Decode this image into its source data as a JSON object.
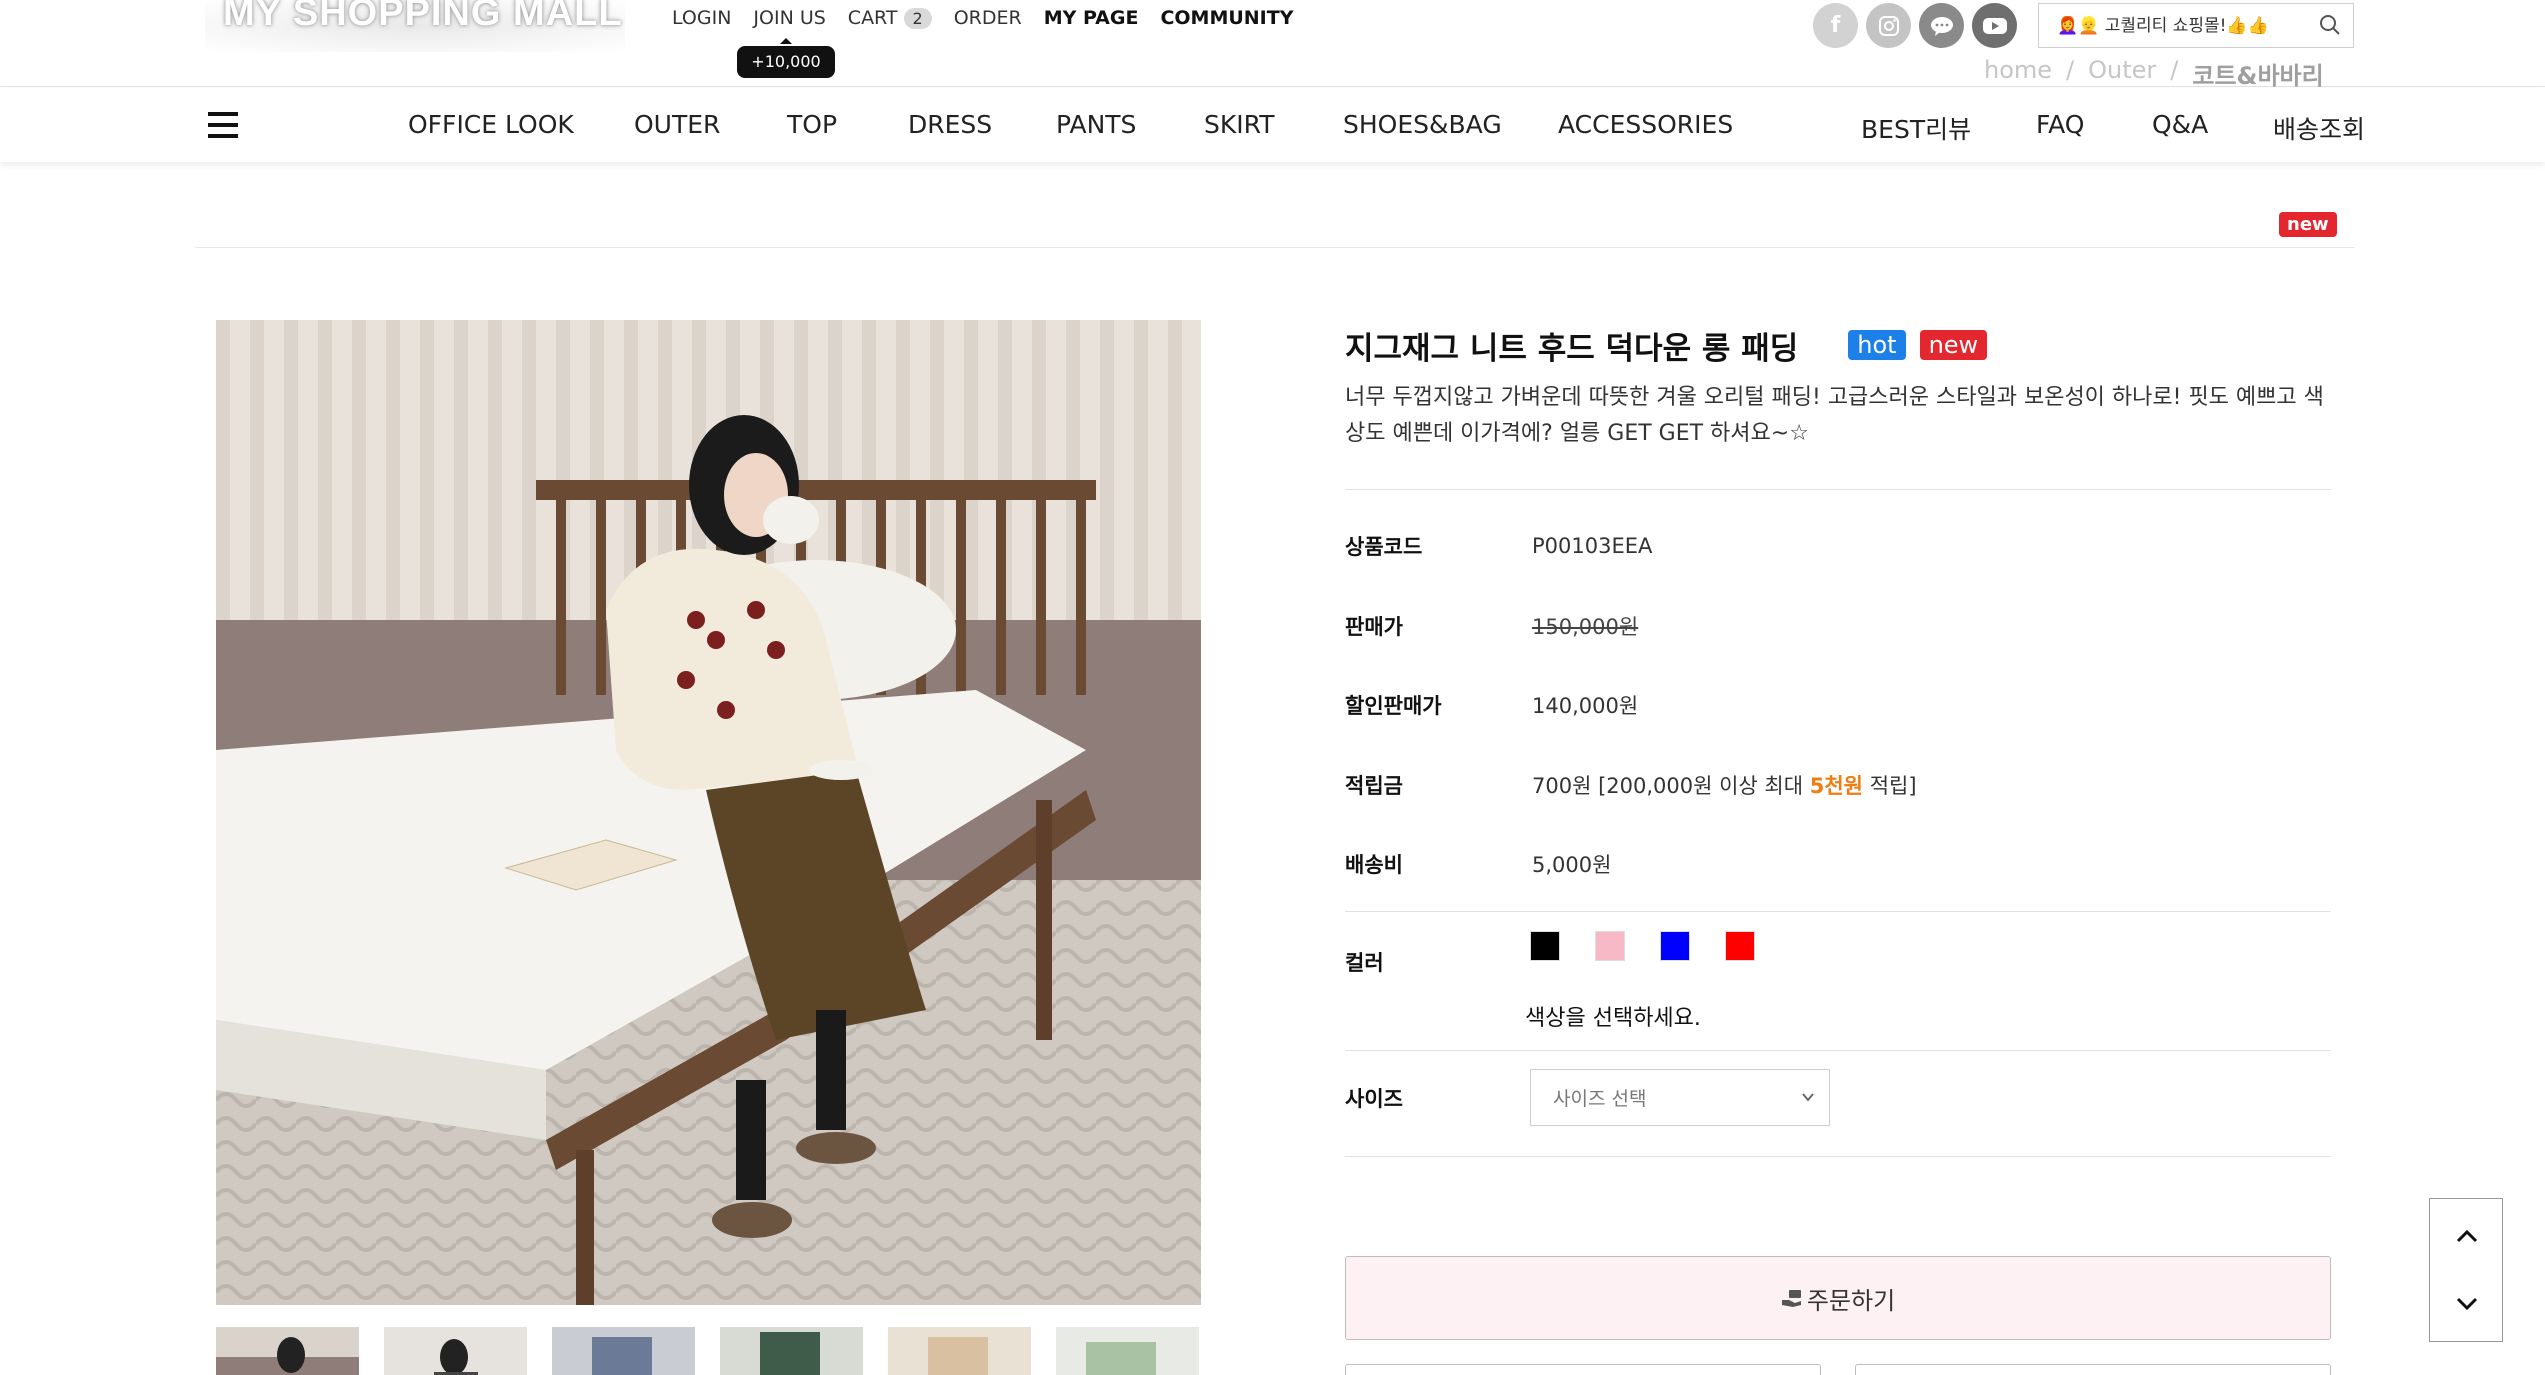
{
  "header": {
    "logo_text": "MY SHOPPING MALL",
    "links": {
      "login": "LOGIN",
      "join": "JOIN US",
      "cart": "CART",
      "cart_count": "2",
      "order": "ORDER",
      "mypage": "MY PAGE",
      "community": "COMMUNITY"
    },
    "join_tooltip": "+10,000",
    "social": [
      "facebook-icon",
      "instagram-icon",
      "talk-icon",
      "youtube-icon"
    ],
    "search_placeholder": "👩‍🦰👱 고퀄리티 쇼핑몰!👍👍",
    "breadcrumb": {
      "home": "home",
      "sep": "/",
      "outer": "Outer",
      "current": "코트&바바리"
    }
  },
  "nav": {
    "items": [
      "OFFICE LOOK",
      "OUTER",
      "TOP",
      "DRESS",
      "PANTS",
      "SKIRT",
      "SHOES&BAG",
      "ACCESSORIES"
    ],
    "right_items": [
      "BEST리뷰",
      "FAQ",
      "Q&A",
      "배송조회"
    ]
  },
  "section_badge": "new",
  "product": {
    "name": "지그재그 니트 후드 덕다운 롱 패딩",
    "tags": {
      "hot": "hot",
      "new": "new"
    },
    "description": "너무 두껍지않고 가벼운데 따뜻한 겨울 오리털 패딩! 고급스러운 스타일과 보온성이 하나로! 핏도 예쁘고 색상도 예쁜데 이가격에? 얼릉 GET GET 하셔요~☆",
    "rows": {
      "code_label": "상품코드",
      "code_value": "P00103EEA",
      "price_label": "판매가",
      "price_value": "150,000원",
      "sale_label": "할인판매가",
      "sale_value": "140,000원",
      "points_label": "적립금",
      "points_value_pre": "700원 [200,000원 이상 최대 ",
      "points_highlight": "5천원",
      "points_value_post": " 적립]",
      "shipping_label": "배송비",
      "shipping_value": "5,000원",
      "color_label": "컬러",
      "size_label": "사이즈"
    },
    "colors": [
      "#000000",
      "#f7b9c6",
      "#0000ff",
      "#ff0000"
    ],
    "color_hint": "색상을 선택하세요.",
    "size_placeholder": "사이즈 선택",
    "order_button": "주문하기"
  }
}
